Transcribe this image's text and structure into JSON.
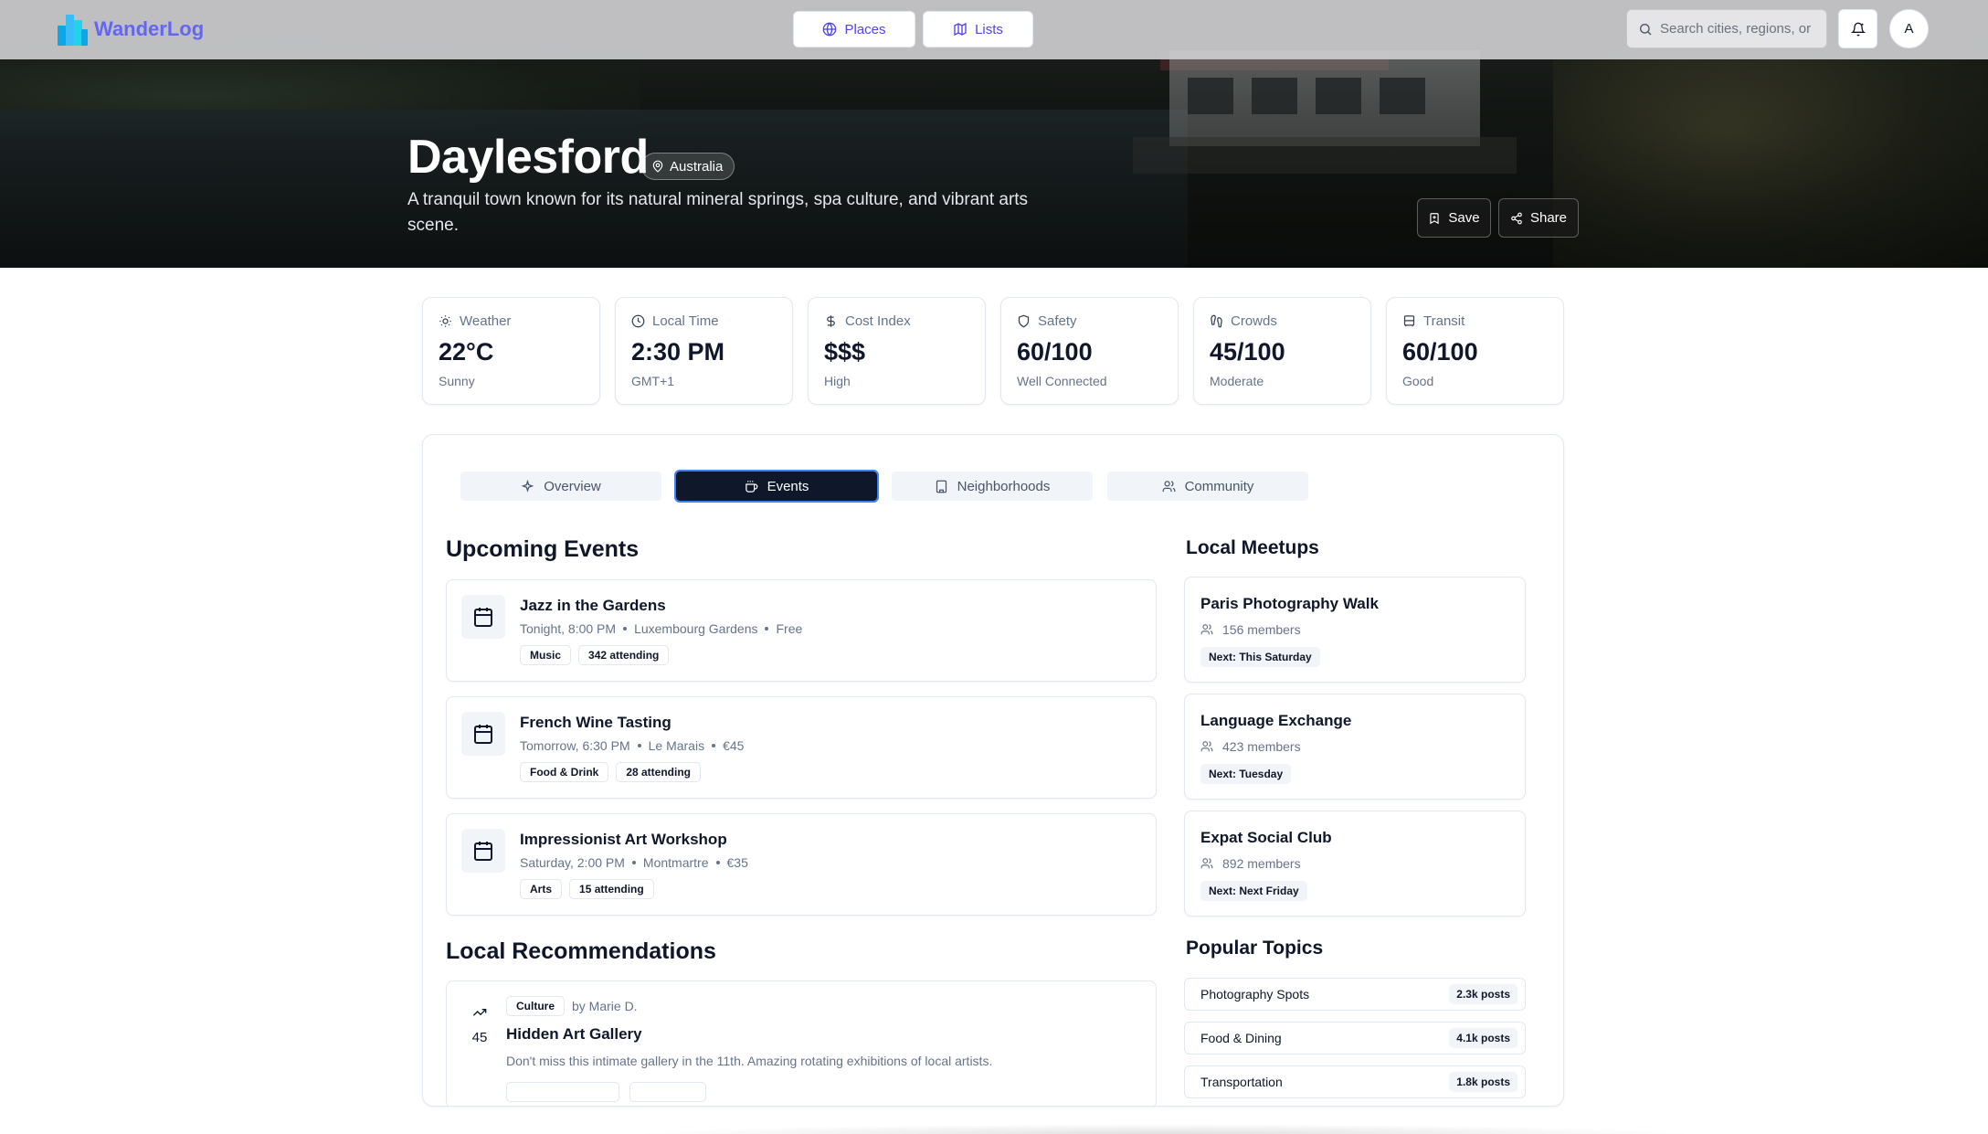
{
  "app": {
    "name": "WanderLog"
  },
  "nav": {
    "places_label": "Places",
    "lists_label": "Lists",
    "search_placeholder": "Search cities, regions, or",
    "avatar_initial": "A"
  },
  "city": {
    "name": "Daylesford",
    "country": "Australia",
    "description": "A tranquil town known for its natural mineral springs, spa culture, and vibrant arts scene.",
    "save_label": "Save",
    "share_label": "Share"
  },
  "stats": [
    {
      "label": "Weather",
      "value": "22°C",
      "sub": "Sunny",
      "icon": "sun-icon"
    },
    {
      "label": "Local Time",
      "value": "2:30 PM",
      "sub": "GMT+1",
      "icon": "clock-icon"
    },
    {
      "label": "Cost Index",
      "value": "$$$",
      "sub": "High",
      "icon": "dollar-icon"
    },
    {
      "label": "Safety",
      "value": "60/100",
      "sub": "Well Connected",
      "icon": "shield-icon"
    },
    {
      "label": "Crowds",
      "value": "45/100",
      "sub": "Moderate",
      "icon": "footprints-icon"
    },
    {
      "label": "Transit",
      "value": "60/100",
      "sub": "Good",
      "icon": "bus-icon"
    }
  ],
  "tabs": [
    {
      "label": "Overview",
      "icon": "sparkles-icon"
    },
    {
      "label": "Events",
      "icon": "coffee-icon",
      "active": true
    },
    {
      "label": "Neighborhoods",
      "icon": "building-icon"
    },
    {
      "label": "Community",
      "icon": "users-icon"
    }
  ],
  "events": {
    "title": "Upcoming Events",
    "items": [
      {
        "title": "Jazz in the Gardens",
        "time": "Tonight, 8:00 PM",
        "place": "Luxembourg Gardens",
        "price": "Free",
        "category": "Music",
        "attending": "342 attending"
      },
      {
        "title": "French Wine Tasting",
        "time": "Tomorrow, 6:30 PM",
        "place": "Le Marais",
        "price": "€45",
        "category": "Food & Drink",
        "attending": "28 attending"
      },
      {
        "title": "Impressionist Art Workshop",
        "time": "Saturday, 2:00 PM",
        "place": "Montmartre",
        "price": "€35",
        "category": "Arts",
        "attending": "15 attending"
      }
    ]
  },
  "meetups": {
    "title": "Local Meetups",
    "items": [
      {
        "title": "Paris Photography Walk",
        "members": "156 members",
        "next": "Next: This Saturday"
      },
      {
        "title": "Language Exchange",
        "members": "423 members",
        "next": "Next: Tuesday"
      },
      {
        "title": "Expat Social Club",
        "members": "892 members",
        "next": "Next: Next Friday"
      }
    ]
  },
  "recommendations": {
    "title": "Local Recommendations",
    "items": [
      {
        "category": "Culture",
        "author": "by Marie D.",
        "title": "Hidden Art Gallery",
        "text": "Don't miss this intimate gallery in the 11th. Amazing rotating exhibitions of local artists.",
        "votes": "45"
      }
    ]
  },
  "topics": {
    "title": "Popular Topics",
    "items": [
      {
        "name": "Photography Spots",
        "count": "2.3k posts"
      },
      {
        "name": "Food & Dining",
        "count": "4.1k posts"
      },
      {
        "name": "Transportation",
        "count": "1.8k posts"
      }
    ]
  },
  "colors": {
    "brand": "#6366f1",
    "active_tab": "#0f172a",
    "focus_ring": "#3b82f6"
  }
}
